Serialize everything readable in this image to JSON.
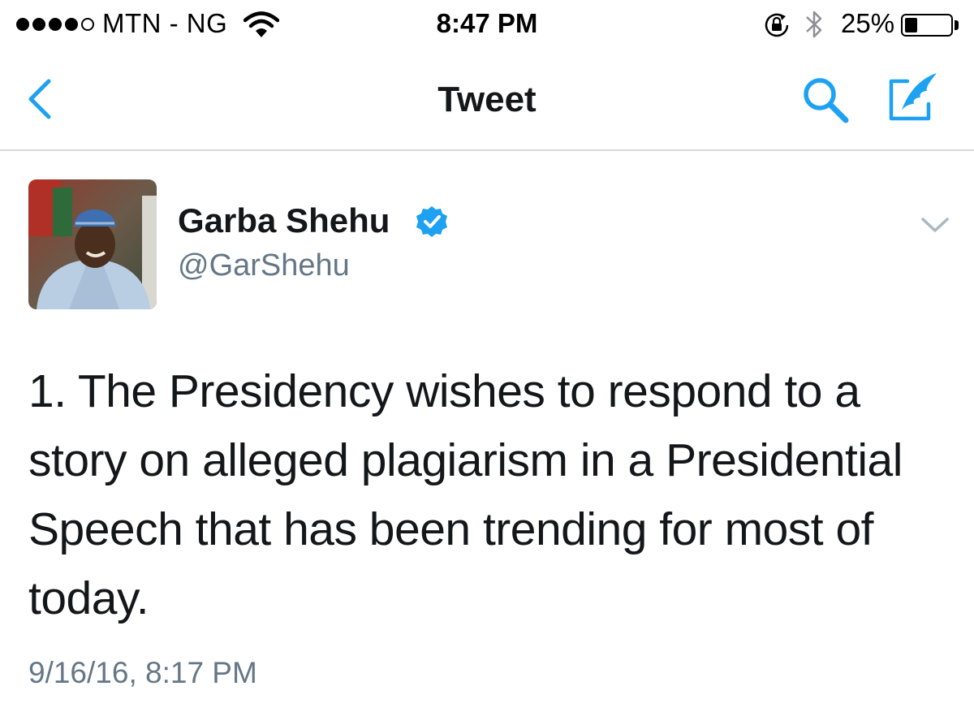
{
  "status_bar": {
    "carrier": "MTN - NG",
    "time": "8:47 PM",
    "battery_percent": "25%",
    "battery_level": 0.25,
    "signal_bars_filled": 4,
    "signal_bars_total": 5,
    "icons": [
      "wifi-icon",
      "rotation-lock-icon",
      "bluetooth-icon",
      "battery-icon"
    ]
  },
  "nav": {
    "title": "Tweet",
    "back_icon": "chevron-left-icon",
    "search_icon": "search-icon",
    "compose_icon": "compose-tweet-icon"
  },
  "tweet": {
    "display_name": "Garba Shehu",
    "verified": true,
    "handle": "@GarShehu",
    "text": "1. The Presidency wishes to respond to a story on alleged plagiarism in a Presidential Speech that has been trending for most of today.",
    "timestamp": "9/16/16, 8:17 PM"
  },
  "colors": {
    "accent": "#1da1f2",
    "text": "#14171a",
    "secondary_text": "#657786",
    "divider": "#d8d8d8",
    "verified_badge": "#1da1f2"
  }
}
